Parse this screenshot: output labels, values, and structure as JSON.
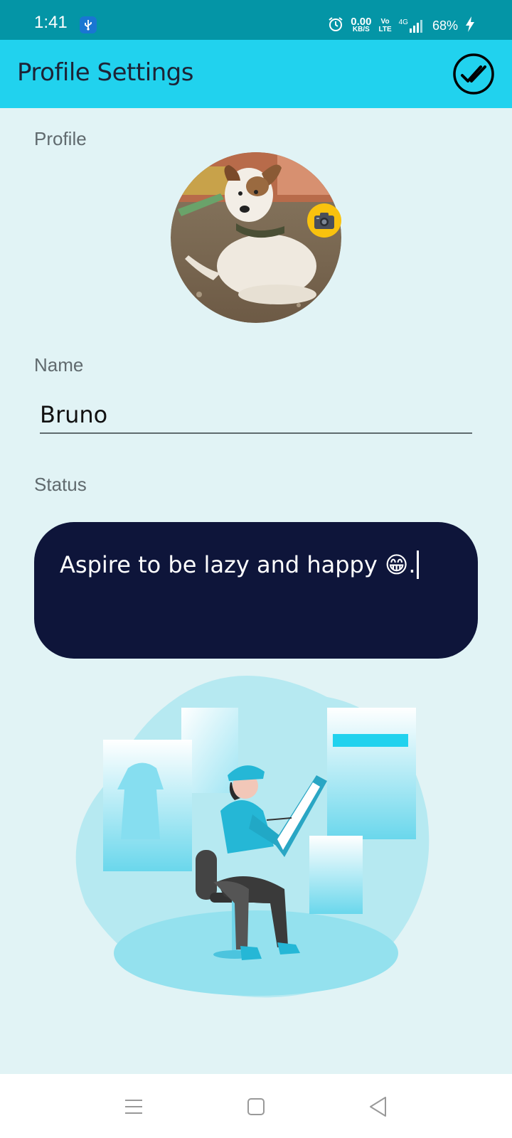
{
  "status_bar": {
    "time": "1:41",
    "net_speed_value": "0.00",
    "net_speed_unit": "KB/S",
    "volte_top": "Vo",
    "volte_bottom": "LTE",
    "network": "4G",
    "battery": "68%",
    "icons": [
      "usb-icon",
      "alarm-icon",
      "signal-icon",
      "charging-icon"
    ]
  },
  "app_bar": {
    "title": "Profile Settings",
    "done_icon": "double-check-icon"
  },
  "profile": {
    "label": "Profile",
    "camera_icon": "camera-icon"
  },
  "name": {
    "label": "Name",
    "value": "Bruno"
  },
  "status": {
    "label": "Status",
    "value": "Aspire to be lazy and happy 😁."
  },
  "nav_bar": {
    "icons": [
      "menu-icon",
      "home-icon",
      "back-icon"
    ]
  },
  "colors": {
    "status_bar": "#0495a6",
    "app_bar": "#21d2ee",
    "background": "#e1f3f5",
    "status_box": "#0e153a",
    "camera_badge": "#f9c20e"
  }
}
